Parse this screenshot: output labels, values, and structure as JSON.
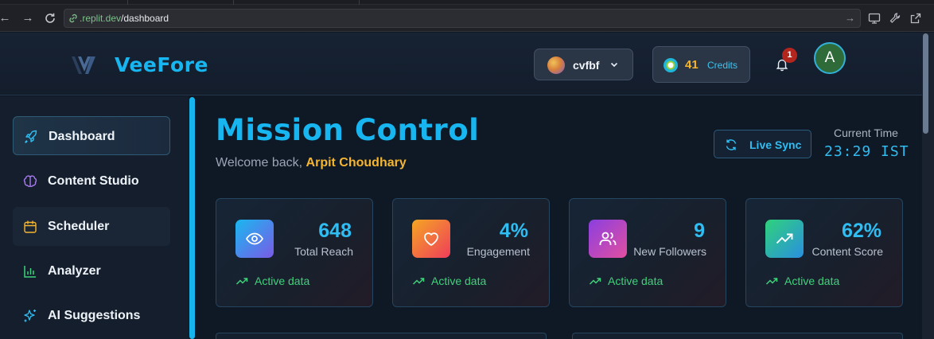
{
  "browser": {
    "url_host": ".replit.dev",
    "url_path": "/dashboard"
  },
  "brand": {
    "name": "VeeFore",
    "accent": "#17b6f0"
  },
  "header": {
    "workspace": "cvfbf",
    "credits_count": "41",
    "credits_label": "Credits",
    "notifications_count": "1",
    "avatar_initial": "A"
  },
  "sidebar": {
    "items": [
      {
        "label": "Dashboard",
        "icon": "rocket-icon",
        "active": true
      },
      {
        "label": "Content Studio",
        "icon": "brain-icon"
      },
      {
        "label": "Scheduler",
        "icon": "calendar-icon"
      },
      {
        "label": "Analyzer",
        "icon": "bar-chart-icon"
      },
      {
        "label": "AI Suggestions",
        "icon": "sparkles-icon"
      }
    ]
  },
  "main": {
    "title": "Mission Control",
    "welcome_prefix": "Welcome back,",
    "user_name": "Arpit Choudhary",
    "live_sync_label": "Live Sync",
    "time_label": "Current Time",
    "time_value": "23:29 IST"
  },
  "stats": [
    {
      "value": "648",
      "label": "Total Reach",
      "icon": "eye-icon",
      "footer": "Active data"
    },
    {
      "value": "4%",
      "label": "Engagement",
      "icon": "heart-icon",
      "footer": "Active data"
    },
    {
      "value": "9",
      "label": "New Followers",
      "icon": "users-icon",
      "footer": "Active data"
    },
    {
      "value": "62%",
      "label": "Content Score",
      "icon": "trending-up-icon",
      "footer": "Active data"
    }
  ]
}
